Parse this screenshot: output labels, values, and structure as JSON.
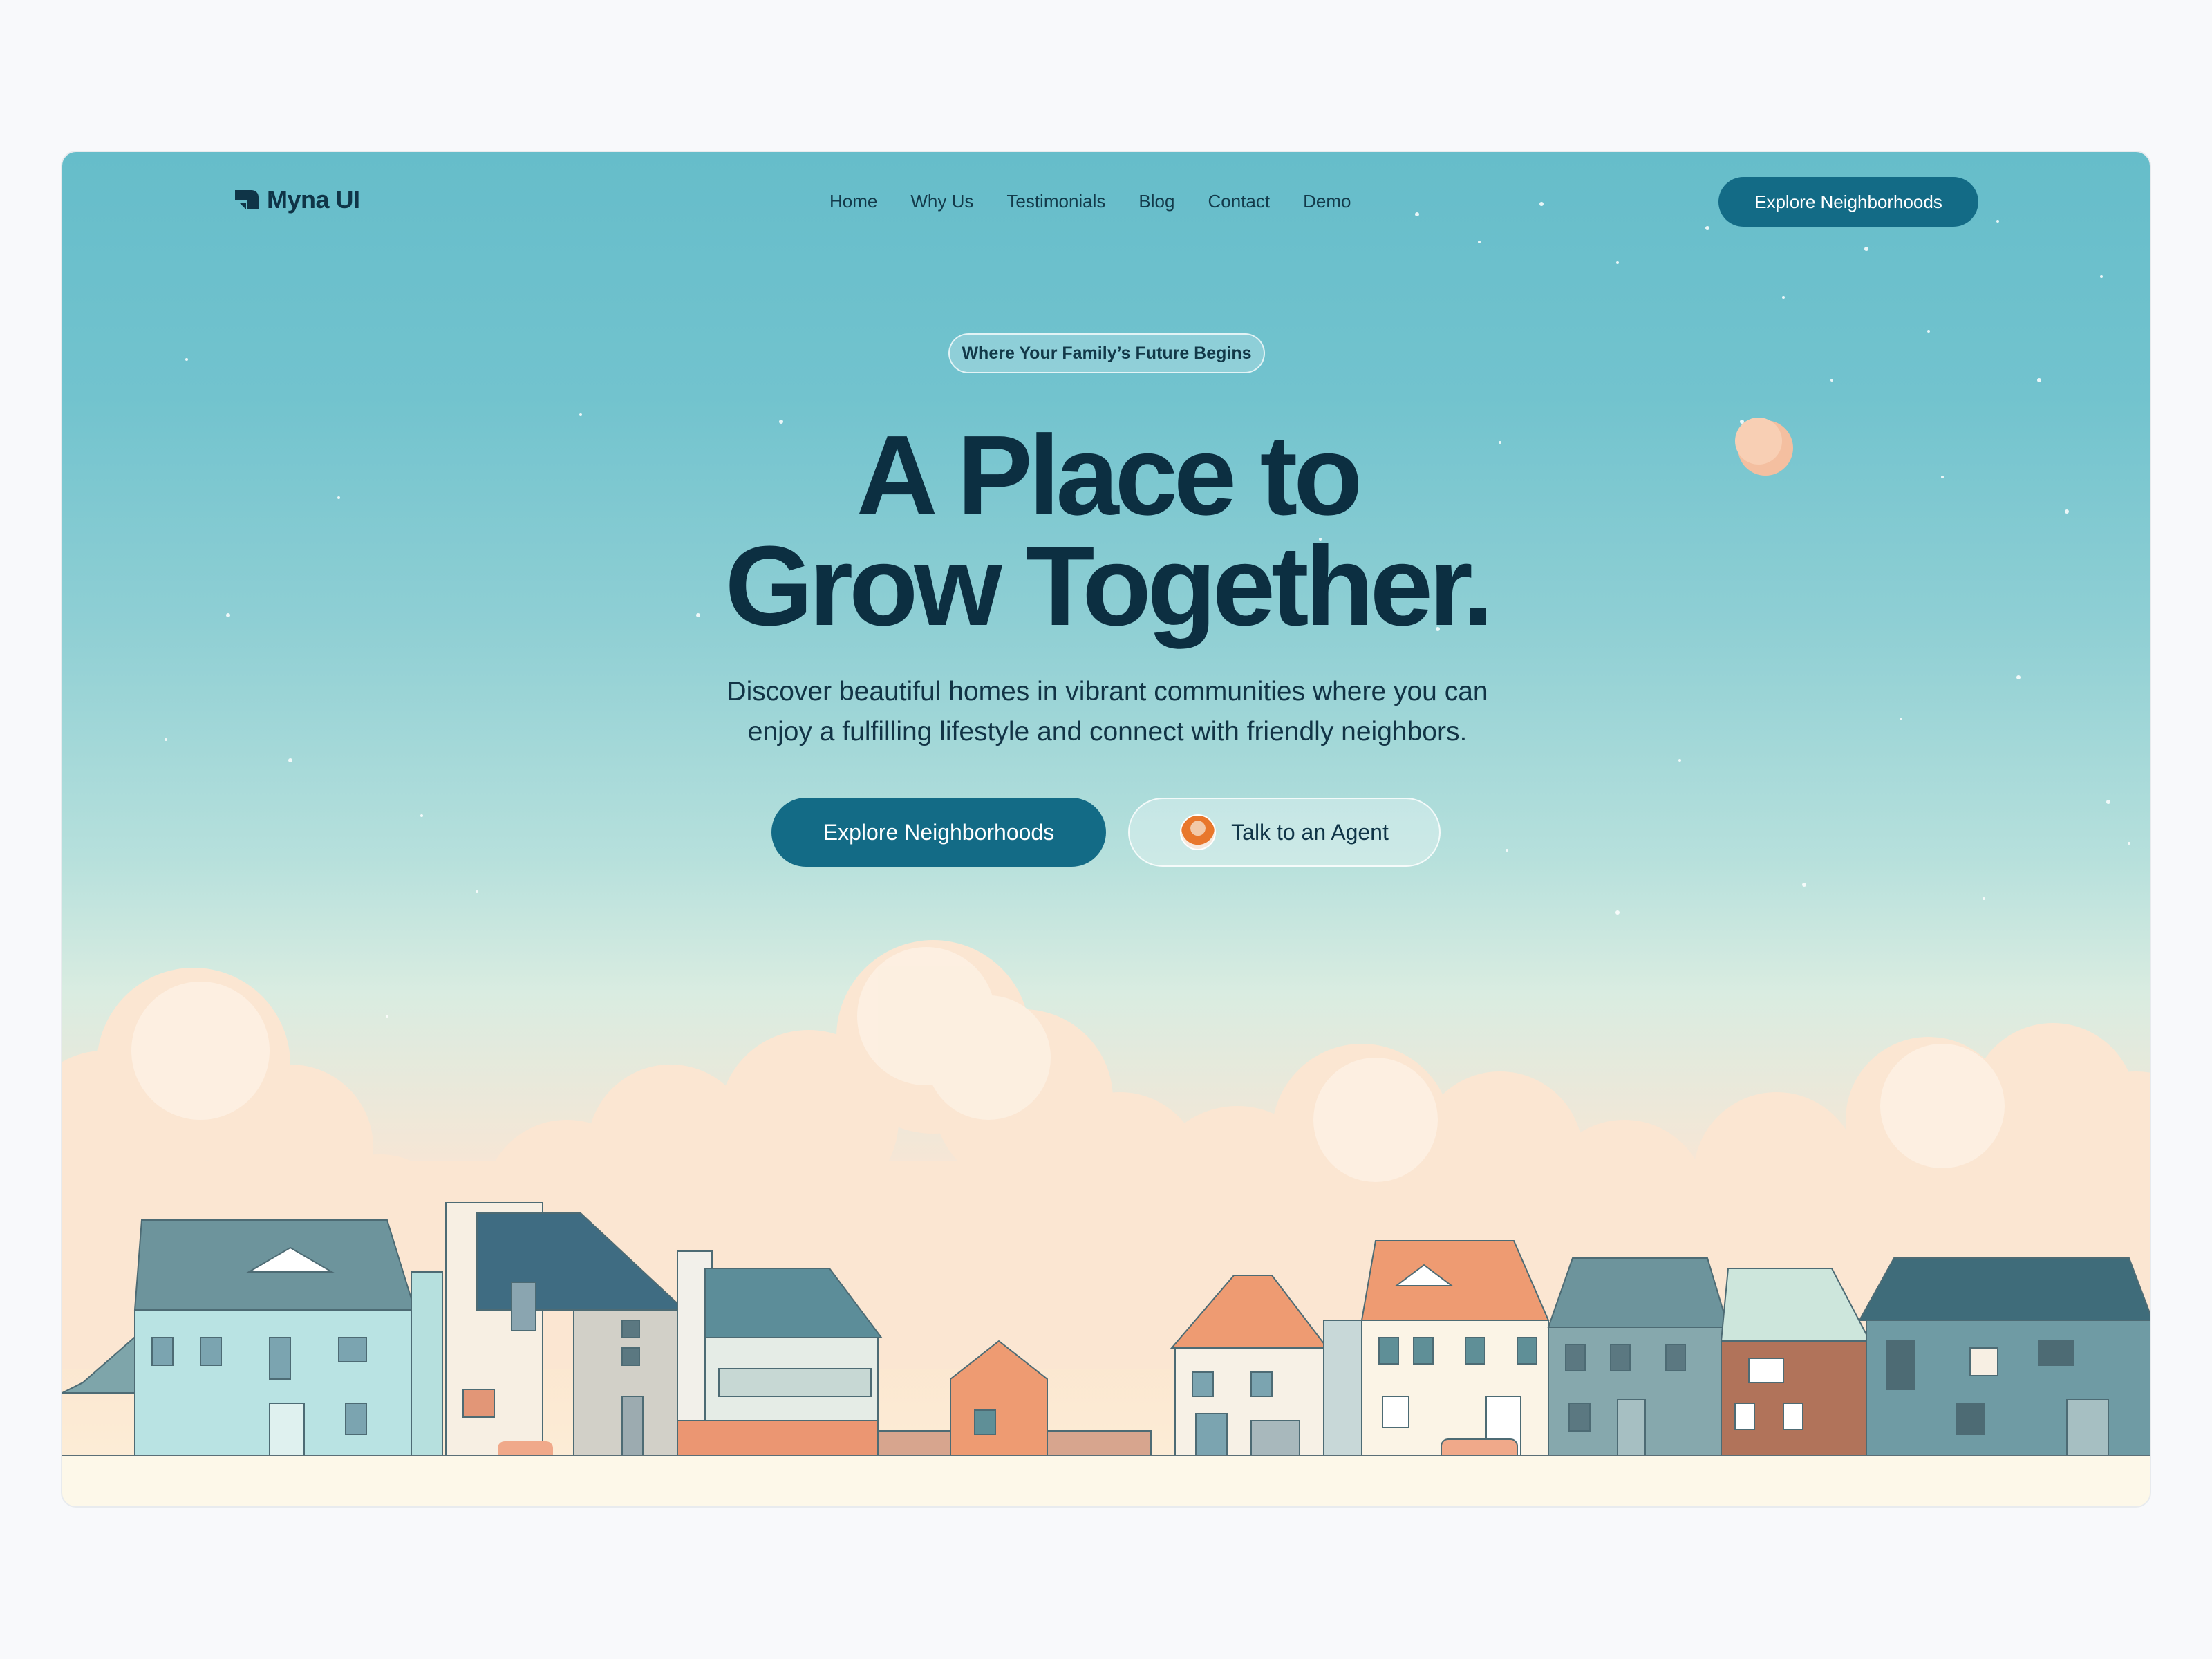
{
  "brand": {
    "name": "Myna UI",
    "icon": "myna-logo-icon"
  },
  "nav": {
    "items": [
      "Home",
      "Why Us",
      "Testimonials",
      "Blog",
      "Contact",
      "Demo"
    ],
    "cta_label": "Explore Neighborhoods"
  },
  "hero": {
    "badge": "Where Your Family’s Future Begins",
    "headline_line1": "A Place to",
    "headline_line2": "Grow Together.",
    "subtitle_line1": "Discover beautiful homes in vibrant communities where you can",
    "subtitle_line2": "enjoy a fulfilling lifestyle and connect with friendly neighbors.",
    "primary_label": "Explore Neighborhoods",
    "secondary_label": "Talk to an Agent",
    "secondary_icon": "agent-avatar"
  },
  "colors": {
    "primary": "#136b86",
    "heading": "#0c2f41",
    "sky_top": "#66bdca",
    "house_orange": "#ee9b72",
    "house_teal": "#5f8f97"
  }
}
